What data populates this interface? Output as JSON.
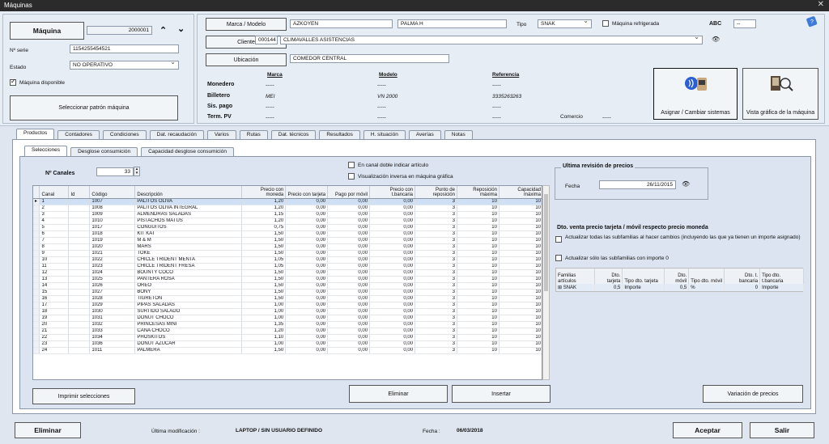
{
  "window": {
    "title": "Máquinas",
    "close": "✕"
  },
  "machine": {
    "button": "Máquina",
    "number": "2000001",
    "serial_label": "Nº serie",
    "serial_value": "1154255454521",
    "state_label": "Estado",
    "state_value": "NO OPERATIVO",
    "available_label": "Máquina disponible",
    "pattern_button": "Seleccionar patrón máquina"
  },
  "header": {
    "brand_button": "Marca / Modelo",
    "brand_value": "AZKOYEN",
    "model_value": "PALMA H",
    "type_label": "Tipo",
    "type_value": "SNAK",
    "fridge_label": "Máquina refrigerada",
    "abc_label": "ABC",
    "abc_value": "--",
    "client_button": "Cliente",
    "client_code": "000144",
    "client_name": "CLIMAVALLES ASISTENCIAS",
    "location_button": "Ubicación",
    "location_value": "COMEDOR CENTRAL"
  },
  "devices": {
    "col_brand": "Marca",
    "col_model": "Modelo",
    "col_ref": "Referencia",
    "rows": [
      {
        "label": "Monedero",
        "brand": "-----",
        "model": "-----",
        "ref": "-----"
      },
      {
        "label": "Billetero",
        "brand": "MEI",
        "model": "VN 2000",
        "ref": "3335263263"
      },
      {
        "label": "Sis. pago",
        "brand": "-----",
        "model": "-----",
        "ref": "-----"
      },
      {
        "label": "Term. PV",
        "brand": "-----",
        "model": "-----",
        "ref": "-----"
      }
    ],
    "comercio_label": "Comercio",
    "comercio_value": "-----"
  },
  "actions": {
    "assign": "Asignar / Cambiar sistemas",
    "graphic": "Vista gráfica de la máquina"
  },
  "tabs": [
    "Productos",
    "Contadores",
    "Condiciones",
    "Dat. recaudación",
    "Varios",
    "Rutas",
    "Dat. técnicos",
    "Resultados",
    "H. situación",
    "Averías",
    "Notas"
  ],
  "subtabs": [
    "Selecciones",
    "Desglose consumición",
    "Capacidad desglose consumición"
  ],
  "selections": {
    "channels_label": "Nº Canales",
    "channels_value": "33",
    "double_channel": "En canal doble indicar artículo",
    "inverse_view": "Visualización inversa en máquina gráfica",
    "headers": [
      "Canal",
      "Id",
      "Código",
      "Descripción",
      "Precio con moneda",
      "Precio con tarjeta",
      "Pago por móvil",
      "Precio con t.bancaria",
      "Punto de reposición",
      "Reposición máxima",
      "Capacidad máxima"
    ],
    "rows": [
      [
        "1",
        "",
        "1007",
        "PALITOS OLIVA",
        "1,20",
        "0,00",
        "0,00",
        "0,00",
        "3",
        "10",
        "10"
      ],
      [
        "2",
        "",
        "1008",
        "PALITOS OLIVA INTEGRAL",
        "1,20",
        "0,00",
        "0,00",
        "0,00",
        "3",
        "10",
        "10"
      ],
      [
        "3",
        "",
        "1009",
        "ALMENDRAS SALADAS",
        "1,15",
        "0,00",
        "0,00",
        "0,00",
        "3",
        "10",
        "10"
      ],
      [
        "4",
        "",
        "1010",
        "PISTACHOS MATUS",
        "1,20",
        "0,00",
        "0,00",
        "0,00",
        "3",
        "10",
        "10"
      ],
      [
        "5",
        "",
        "1017",
        "CONGUITOS",
        "0,75",
        "0,00",
        "0,00",
        "0,00",
        "3",
        "10",
        "10"
      ],
      [
        "6",
        "",
        "1018",
        "KIT KAT",
        "1,50",
        "0,00",
        "0,00",
        "0,00",
        "3",
        "10",
        "10"
      ],
      [
        "7",
        "",
        "1019",
        "M & M",
        "1,50",
        "0,00",
        "0,00",
        "0,00",
        "3",
        "10",
        "10"
      ],
      [
        "8",
        "",
        "1020",
        "MARS",
        "1,50",
        "0,00",
        "0,00",
        "0,00",
        "3",
        "10",
        "10"
      ],
      [
        "9",
        "",
        "1021",
        "TOKE",
        "1,50",
        "0,00",
        "0,00",
        "0,00",
        "3",
        "10",
        "10"
      ],
      [
        "10",
        "",
        "1022",
        "CHICLE TRIDENT MENTA",
        "1,05",
        "0,00",
        "0,00",
        "0,00",
        "3",
        "10",
        "10"
      ],
      [
        "11",
        "",
        "1023",
        "CHICLE TRIDENT FRESA",
        "1,05",
        "0,00",
        "0,00",
        "0,00",
        "3",
        "10",
        "10"
      ],
      [
        "12",
        "",
        "1024",
        "BOUNTY COCO",
        "1,50",
        "0,00",
        "0,00",
        "0,00",
        "3",
        "10",
        "10"
      ],
      [
        "13",
        "",
        "1025",
        "PANTERA ROSA",
        "1,50",
        "0,00",
        "0,00",
        "0,00",
        "3",
        "10",
        "10"
      ],
      [
        "14",
        "",
        "1026",
        "OREO",
        "1,50",
        "0,00",
        "0,00",
        "0,00",
        "3",
        "10",
        "10"
      ],
      [
        "15",
        "",
        "1027",
        "BONY",
        "1,50",
        "0,00",
        "0,00",
        "0,00",
        "3",
        "10",
        "10"
      ],
      [
        "16",
        "",
        "1028",
        "TIGRETON",
        "1,50",
        "0,00",
        "0,00",
        "0,00",
        "3",
        "10",
        "10"
      ],
      [
        "17",
        "",
        "1029",
        "PIPAS SALADAS",
        "1,00",
        "0,00",
        "0,00",
        "0,00",
        "3",
        "10",
        "10"
      ],
      [
        "18",
        "",
        "1030",
        "SURTIDO SALADO",
        "1,00",
        "0,00",
        "0,00",
        "0,00",
        "3",
        "10",
        "10"
      ],
      [
        "19",
        "",
        "1031",
        "DONUT CHOCO",
        "1,00",
        "0,00",
        "0,00",
        "0,00",
        "3",
        "10",
        "10"
      ],
      [
        "20",
        "",
        "1032",
        "PRINCESAS MINI",
        "1,35",
        "0,00",
        "0,00",
        "0,00",
        "3",
        "10",
        "10"
      ],
      [
        "21",
        "",
        "1033",
        "CAÑA CHOCO",
        "1,20",
        "0,00",
        "0,00",
        "0,00",
        "3",
        "10",
        "10"
      ],
      [
        "22",
        "",
        "1034",
        "PHOSKITOS",
        "1,10",
        "0,00",
        "0,00",
        "0,00",
        "3",
        "10",
        "10"
      ],
      [
        "23",
        "",
        "1036",
        "DONUT AZUCAR",
        "1,00",
        "0,00",
        "0,00",
        "0,00",
        "3",
        "10",
        "10"
      ],
      [
        "24",
        "",
        "1011",
        "PALMERA",
        "1,50",
        "0,00",
        "0,00",
        "0,00",
        "3",
        "10",
        "10"
      ]
    ],
    "print_button": "Imprimir selecciones",
    "delete_button": "Eliminar",
    "insert_button": "Insertar"
  },
  "price_review": {
    "title": "Ultima revisión de precios",
    "date_label": "Fecha",
    "date_value": "26/11/2015"
  },
  "discount": {
    "title": "Dto. venta precio tarjeta / móvil respecto precio moneda",
    "opt_all": "Actualizar todas las subfamilias al hacer cambios (incluyendo las que ya tienen un importe asignado)",
    "opt_zero": "Actualizar sólo las subfamilias con importe 0",
    "headers": [
      "Familias artículos",
      "Dto. tarjeta",
      "Tipo dto. tarjeta",
      "Dto. móvil",
      "Tipo dto. móvil",
      "Dto. t. bancaria",
      "Tipo dto. t.bancaria"
    ],
    "rows": [
      [
        "SNAK",
        "0,5",
        "Importe",
        "0,5",
        "%",
        "0",
        "Importe"
      ]
    ],
    "variation_button": "Variación de precios"
  },
  "footer": {
    "delete_button": "Eliminar",
    "modified_label": "Última modificación :",
    "modified_value": "LAPTOP / SIN USUARIO DEFINIDO",
    "date_label": "Fecha :",
    "date_value": "06/03/2018",
    "accept_button": "Aceptar",
    "exit_button": "Salir"
  }
}
